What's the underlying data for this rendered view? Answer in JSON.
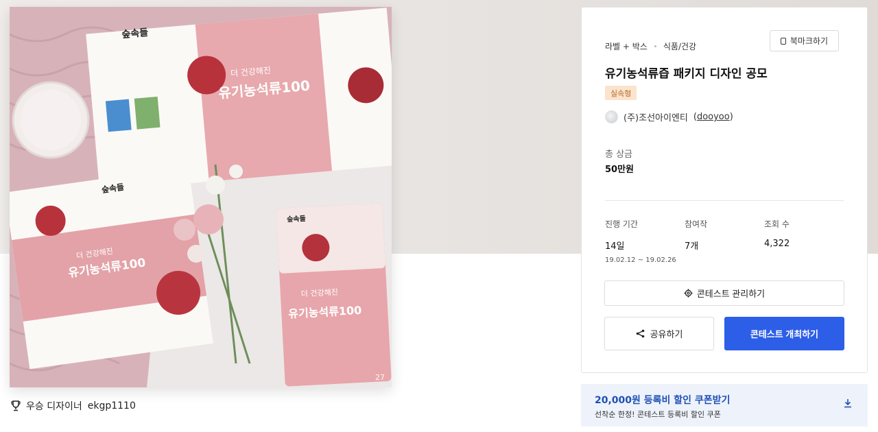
{
  "hero": {
    "image_counter": "27",
    "product_brand": "숲속들",
    "product_name_line1": "더 건강해진",
    "product_name_line2": "유기농석류100"
  },
  "winner": {
    "icon": "trophy-icon",
    "label": "우승 디자이너",
    "designer": "ekgp1110"
  },
  "contest": {
    "category_1": "라벨 + 박스",
    "category_2": "식품/건강",
    "bookmark_label": "북마크하기",
    "title": "유기농석류즙 패키지 디자인 공모",
    "badge": "실속형",
    "host_name": "(주)조선아이엔티",
    "host_id": "dooyoo",
    "prize_label": "총 상금",
    "prize_value": "50만원",
    "period_label": "진행 기간",
    "period_value": "14일",
    "period_dates": "19.02.12 ~ 19.02.26",
    "entries_label": "참여작",
    "entries_value": "7개",
    "views_label": "조회 수",
    "views_value": "4,322",
    "manage_label": "콘테스트 관리하기",
    "share_label": "공유하기",
    "host_contest_label": "콘테스트 개최하기"
  },
  "coupon": {
    "title": "20,000원 등록비 할인 쿠폰받기",
    "subtitle": "선착순 한정! 콘테스트 등록비 할인 쿠폰"
  },
  "colors": {
    "primary": "#2d5ee8",
    "badge_bg": "#fbe3cd",
    "badge_text": "#b56a2c",
    "coupon_bg": "#eef3fb",
    "coupon_text": "#1f4fb5"
  }
}
